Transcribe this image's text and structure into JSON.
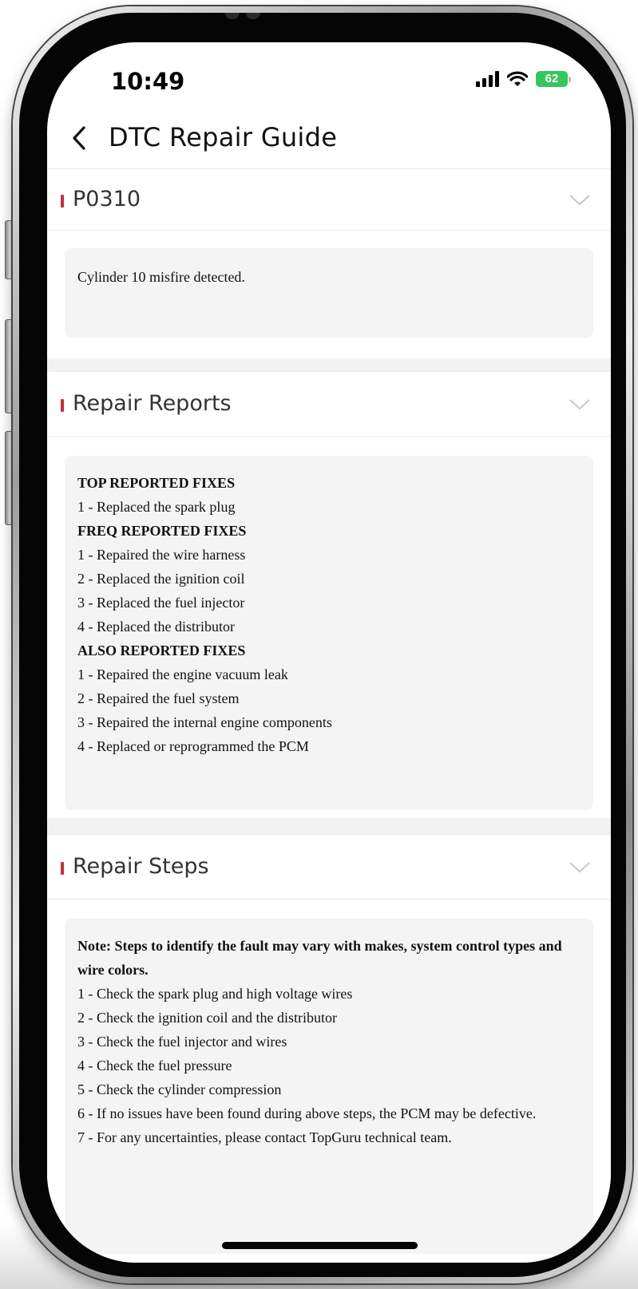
{
  "status_bar": {
    "time": "10:49",
    "battery": "62",
    "battery_color": "#35c759",
    "icons": [
      "cellular-signal-icon",
      "wifi-icon",
      "battery-charging-icon"
    ]
  },
  "nav": {
    "back_icon": "chevron-left-icon",
    "title": "DTC Repair Guide"
  },
  "accent_color": "#d8262f",
  "sections": [
    {
      "title": "P0310",
      "expand_icon": "chevron-down-icon",
      "lines": [
        {
          "text": "Cylinder 10 misfire detected.",
          "bold": false
        }
      ]
    },
    {
      "title": "Repair Reports",
      "expand_icon": "chevron-down-icon",
      "lines": [
        {
          "text": "TOP REPORTED FIXES",
          "bold": true
        },
        {
          "text": "1 - Replaced the spark plug",
          "bold": false
        },
        {
          "text": "FREQ REPORTED FIXES",
          "bold": true
        },
        {
          "text": "1 - Repaired the wire harness",
          "bold": false
        },
        {
          "text": "2 - Replaced the ignition coil",
          "bold": false
        },
        {
          "text": "3 - Replaced the fuel injector",
          "bold": false
        },
        {
          "text": "4 - Replaced the distributor",
          "bold": false
        },
        {
          "text": "ALSO REPORTED FIXES",
          "bold": true
        },
        {
          "text": "1 - Repaired the engine vacuum leak",
          "bold": false
        },
        {
          "text": "2 - Repaired the fuel system",
          "bold": false
        },
        {
          "text": "3 - Repaired the internal engine components",
          "bold": false
        },
        {
          "text": "4 - Replaced or reprogrammed the PCM",
          "bold": false
        }
      ]
    },
    {
      "title": "Repair Steps",
      "expand_icon": "chevron-down-icon",
      "lines": [
        {
          "text": "Note: Steps to identify the fault may vary with makes, system control types and wire colors.",
          "bold": true
        },
        {
          "text": "1 - Check the spark plug and high voltage wires",
          "bold": false
        },
        {
          "text": "2 - Check the ignition coil and the distributor",
          "bold": false
        },
        {
          "text": "3 - Check the fuel injector and wires",
          "bold": false
        },
        {
          "text": "4 - Check the fuel pressure",
          "bold": false
        },
        {
          "text": "5 - Check the cylinder compression",
          "bold": false
        },
        {
          "text": "6 - If no issues have been found during above steps, the PCM may be defective.",
          "bold": false
        },
        {
          "text": "7 - For any uncertainties, please contact TopGuru technical team.",
          "bold": false
        }
      ]
    }
  ]
}
